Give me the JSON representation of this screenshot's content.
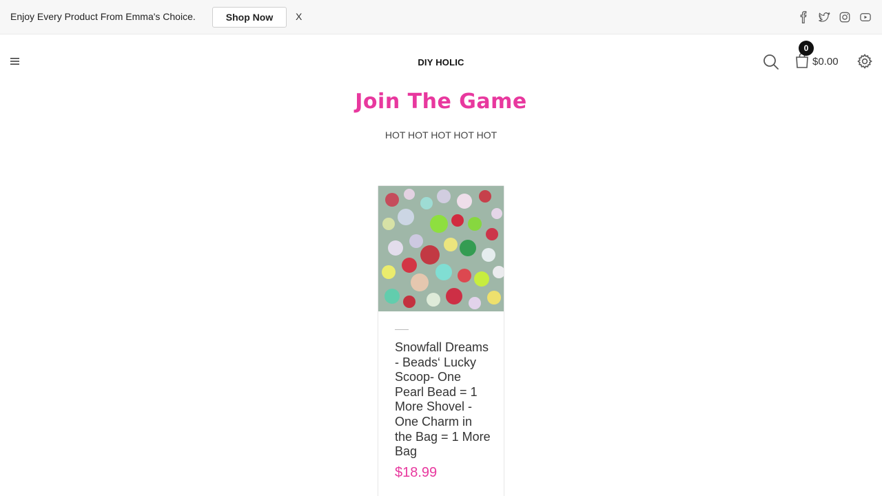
{
  "promo": {
    "text": "Enjoy Every Product From Emma's Choice.",
    "button_label": "Shop Now",
    "close_label": "X"
  },
  "social": [
    {
      "name": "facebook-icon"
    },
    {
      "name": "twitter-icon"
    },
    {
      "name": "instagram-icon"
    },
    {
      "name": "youtube-icon"
    }
  ],
  "header": {
    "site_title": "DIY HOLIC",
    "cart_count": "0",
    "cart_total": "$0.00"
  },
  "page": {
    "title": "Join The Game",
    "subtitle": "HOT HOT HOT HOT HOT"
  },
  "products": [
    {
      "name": "Snowfall Dreams - Beads‘ Lucky Scoop- One Pearl Bead = 1 More Shovel - One Charm in the Bag = 1 More Bag",
      "price": "$18.99"
    }
  ],
  "colors": {
    "accent": "#e8389e",
    "text": "#333333",
    "topbar_bg": "#f7f7f7"
  }
}
